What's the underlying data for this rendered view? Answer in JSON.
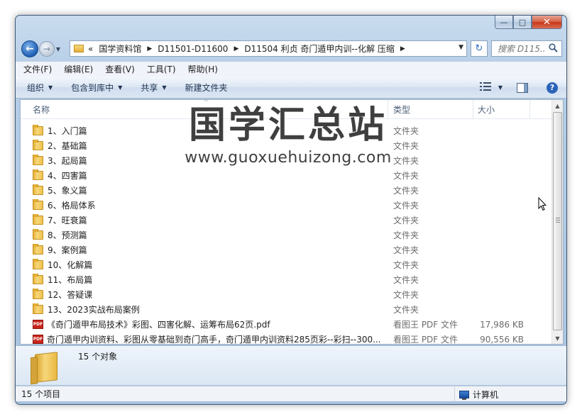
{
  "window": {
    "minimize_symbol": "—",
    "maximize_symbol": "□",
    "close_symbol": "✕"
  },
  "nav": {
    "back_symbol": "←",
    "forward_symbol": "→",
    "history_dropdown": "▼"
  },
  "address_bar": {
    "overflow": "«",
    "crumbs": [
      "国学资料馆",
      "D11501-D11600",
      "D11504 利贞 奇门遁甲内训--化解 压缩"
    ],
    "separator": "▶",
    "dropdown": "▼"
  },
  "refresh_symbol": "↻",
  "search": {
    "placeholder": "搜索 D115...",
    "icon": "search-icon"
  },
  "menu": [
    "文件(F)",
    "编辑(E)",
    "查看(V)",
    "工具(T)",
    "帮助(H)"
  ],
  "toolbar": {
    "items": [
      "组织",
      "包含到库中",
      "共享",
      "新建文件夹"
    ],
    "caret": "▼",
    "help_label": "?"
  },
  "columns": {
    "name": "名称",
    "type": "类型",
    "size": "大小",
    "sort_indicator": "^"
  },
  "files": [
    {
      "name": "1、入门篇",
      "type": "文件夹",
      "size": "",
      "kind": "folder"
    },
    {
      "name": "2、基础篇",
      "type": "文件夹",
      "size": "",
      "kind": "folder"
    },
    {
      "name": "3、起局篇",
      "type": "文件夹",
      "size": "",
      "kind": "folder"
    },
    {
      "name": "4、四害篇",
      "type": "文件夹",
      "size": "",
      "kind": "folder"
    },
    {
      "name": "5、象义篇",
      "type": "文件夹",
      "size": "",
      "kind": "folder"
    },
    {
      "name": "6、格局体系",
      "type": "文件夹",
      "size": "",
      "kind": "folder"
    },
    {
      "name": "7、旺衰篇",
      "type": "文件夹",
      "size": "",
      "kind": "folder"
    },
    {
      "name": "8、预测篇",
      "type": "文件夹",
      "size": "",
      "kind": "folder"
    },
    {
      "name": "9、案例篇",
      "type": "文件夹",
      "size": "",
      "kind": "folder"
    },
    {
      "name": "10、化解篇",
      "type": "文件夹",
      "size": "",
      "kind": "folder"
    },
    {
      "name": "11、布局篇",
      "type": "文件夹",
      "size": "",
      "kind": "folder"
    },
    {
      "name": "12、答疑课",
      "type": "文件夹",
      "size": "",
      "kind": "folder"
    },
    {
      "name": "13、2023实战布局案例",
      "type": "文件夹",
      "size": "",
      "kind": "folder"
    },
    {
      "name": "《奇门遁甲布局技术》彩图、四害化解、运筹布局62页.pdf",
      "type": "看图王 PDF 文件",
      "size": "17,986 KB",
      "kind": "pdf"
    },
    {
      "name": "奇门遁甲内训资料、彩图从零基础到奇门高手，奇门遁甲内训资料285页彩--彩扫--300...",
      "type": "看图王 PDF 文件",
      "size": "90,556 KB",
      "kind": "pdf"
    }
  ],
  "pdf_badge": "PDF",
  "watermark": {
    "title": "国学汇总站",
    "url": "www.guoxuehuizong.com"
  },
  "details_pane": {
    "count_text": "15 个对象"
  },
  "status": {
    "items_count": "15 个项目",
    "location": "计算机"
  },
  "scrollbar": {
    "up": "▲",
    "down": "▼"
  }
}
